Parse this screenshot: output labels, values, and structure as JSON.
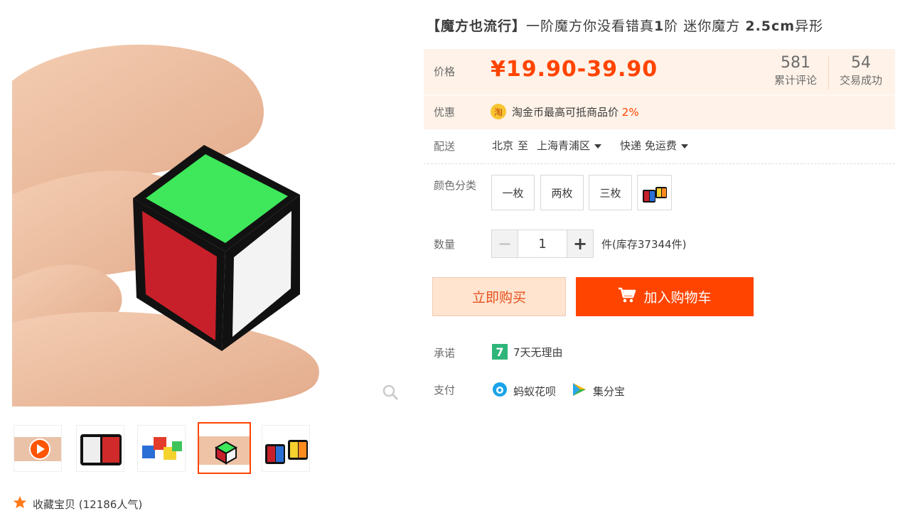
{
  "title": {
    "prefix": "【魔方也流行】",
    "main": "一阶魔方你没看错真",
    "bold1": "1",
    "mid": "阶 迷你魔方 ",
    "bold2": "2.5cm",
    "suffix": "异形"
  },
  "price": {
    "label": "价格",
    "value": "¥19.90-39.90"
  },
  "stats": [
    {
      "num": "581",
      "label": "累计评论"
    },
    {
      "num": "54",
      "label": "交易成功"
    }
  ],
  "promo": {
    "label": "优惠",
    "icon_text": "淘",
    "text": "淘金币最高可抵商品价",
    "percent": "2%"
  },
  "delivery": {
    "label": "配送",
    "from": "北京",
    "to_word": "至",
    "to": "上海青浦区",
    "method": "快递 免运费"
  },
  "color": {
    "label": "颜色分类",
    "options": [
      "一枚",
      "两枚",
      "三枚"
    ]
  },
  "quantity": {
    "label": "数量",
    "minus": "−",
    "plus": "+",
    "value": "1",
    "stock": "件(库存37344件)"
  },
  "actions": {
    "buy_now": "立即购买",
    "add_cart": "加入购物车"
  },
  "promise": {
    "label": "承诺",
    "icon_text": "7",
    "text": "7天无理由"
  },
  "payment": {
    "label": "支付",
    "methods": [
      "蚂蚁花呗",
      "集分宝"
    ]
  },
  "favorite": {
    "text": "收藏宝贝 (12186人气)"
  },
  "colors": {
    "accent": "#ff4400",
    "price_bg": "#fff2e8"
  }
}
